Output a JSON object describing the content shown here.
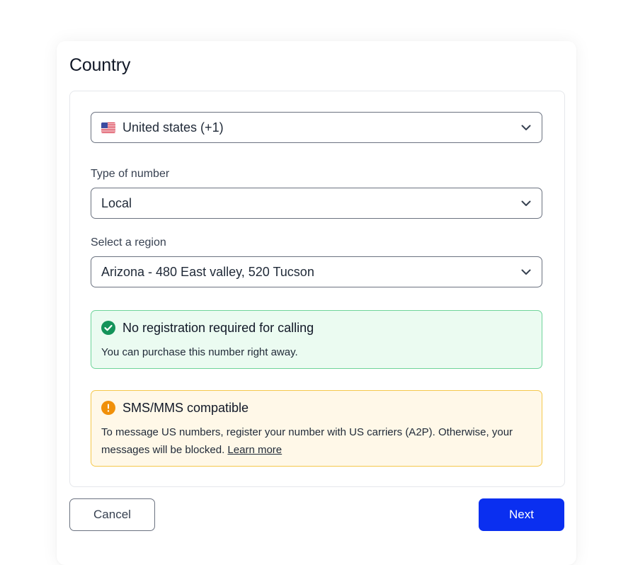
{
  "header": {
    "title": "Country"
  },
  "country_select": {
    "value": "United states (+1)",
    "flag_icon": "us-flag-icon"
  },
  "number_type": {
    "label": "Type of number",
    "value": "Local"
  },
  "region": {
    "label": "Select a region",
    "value": "Arizona - 480 East valley, 520 Tucson"
  },
  "alerts": {
    "success": {
      "icon": "check-circle-icon",
      "title": "No registration required for calling",
      "body": "You can purchase this number right away."
    },
    "warning": {
      "icon": "exclamation-circle-icon",
      "title": "SMS/MMS compatible",
      "body": "To message US numbers, register your number with US carriers (A2P). Otherwise, your messages will be blocked. ",
      "link": "Learn more"
    }
  },
  "footer": {
    "cancel_label": "Cancel",
    "next_label": "Next"
  },
  "colors": {
    "primary": "#0a2ff0",
    "success": "#14935a",
    "warning": "#f0900a"
  }
}
